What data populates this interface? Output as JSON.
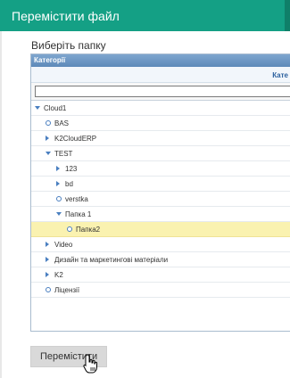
{
  "dialog": {
    "title": "Перемістити файл",
    "folder_label": "Виберіть папку",
    "move_button": "Перемістити"
  },
  "panel": {
    "header": "Категорії",
    "column_header": "Кате",
    "search_value": ""
  },
  "tree": [
    {
      "label": "Cloud1",
      "level": 0,
      "kind": "expanded"
    },
    {
      "label": "BAS",
      "level": 1,
      "kind": "leaf"
    },
    {
      "label": "K2CloudERP",
      "level": 1,
      "kind": "collapsed"
    },
    {
      "label": "TEST",
      "level": 1,
      "kind": "expanded"
    },
    {
      "label": "123",
      "level": 2,
      "kind": "collapsed"
    },
    {
      "label": "bd",
      "level": 2,
      "kind": "collapsed"
    },
    {
      "label": "verstka",
      "level": 2,
      "kind": "leaf"
    },
    {
      "label": "Папка 1",
      "level": 2,
      "kind": "expanded"
    },
    {
      "label": "Папка2",
      "level": 3,
      "kind": "leaf",
      "selected": true
    },
    {
      "label": "Video",
      "level": 1,
      "kind": "collapsed"
    },
    {
      "label": "Дизайн та маркетингові матеріали",
      "level": 1,
      "kind": "collapsed"
    },
    {
      "label": "K2",
      "level": 1,
      "kind": "collapsed"
    },
    {
      "label": "Ліцензії",
      "level": 1,
      "kind": "leaf"
    }
  ],
  "colors": {
    "title_bar": "#14a085",
    "panel_header": "#5d89b9",
    "selected_row": "#faf2b0",
    "tree_icon": "#4a7fc0"
  },
  "icons": {
    "expanded": "triangle-down-icon",
    "collapsed": "triangle-right-icon",
    "leaf": "circle-leaf-icon",
    "cursor": "hand-pointer-icon"
  }
}
